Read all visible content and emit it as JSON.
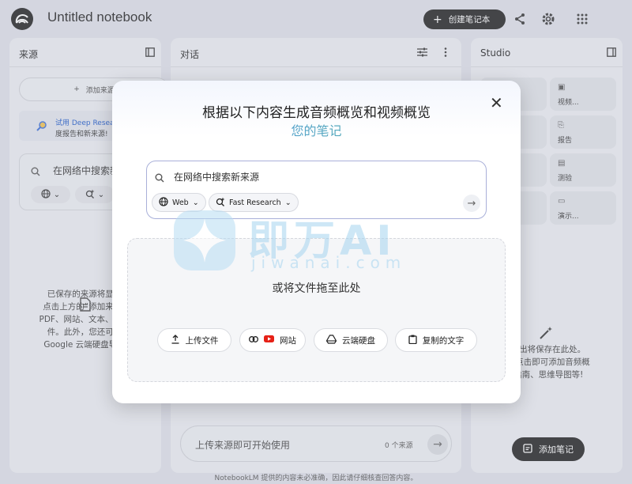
{
  "header": {
    "title": "Untitled notebook",
    "create_label": "创建笔记本"
  },
  "sources": {
    "title": "来源",
    "add_label": "添加来源",
    "promo_line1": "试用 Deep Research",
    "promo_line2": "度报告和新来源!",
    "search_text": "在网络中搜索新来",
    "empty_lines": [
      "已保存的来源将显示",
      "点击上方的“添加来源”",
      "PDF、网站、文本、视频",
      "件。此外，您还可以",
      "Google 云端硬盘导入"
    ]
  },
  "chat": {
    "title": "对话",
    "input_placeholder": "上传来源即可开始使用",
    "source_count": "0 个来源"
  },
  "studio": {
    "title": "Studio",
    "tiles": [
      {
        "label": ""
      },
      {
        "label": "视频..."
      },
      {
        "label": ""
      },
      {
        "label": "报告"
      },
      {
        "label": ""
      },
      {
        "label": "测验"
      },
      {
        "label": ""
      },
      {
        "label": "演示..."
      }
    ],
    "empty_lines": [
      "o 输出将保存在此处。",
      "后，点击即可添加音频概",
      "习指南、思维导图等!"
    ],
    "add_note_label": "添加笔记"
  },
  "footer": "NotebookLM 提供的内容未必准确，因此请仔细核查回答内容。",
  "modal": {
    "title": "根据以下内容生成音频概览和视频概览",
    "subtitle": "您的笔记",
    "search_text": "在网络中搜索新来源",
    "web_chip": "Web",
    "research_chip": "Fast Research",
    "drop_text": "或将文件拖至此处",
    "upload_buttons": [
      {
        "label": "上传文件",
        "icon": "upload-icon"
      },
      {
        "label": "网站",
        "icon": "link-youtube-icon"
      },
      {
        "label": "云端硬盘",
        "icon": "drive-icon"
      },
      {
        "label": "复制的文字",
        "icon": "clipboard-icon"
      }
    ]
  },
  "watermark": {
    "big": "即万AI",
    "small": "jiwanai.com"
  }
}
